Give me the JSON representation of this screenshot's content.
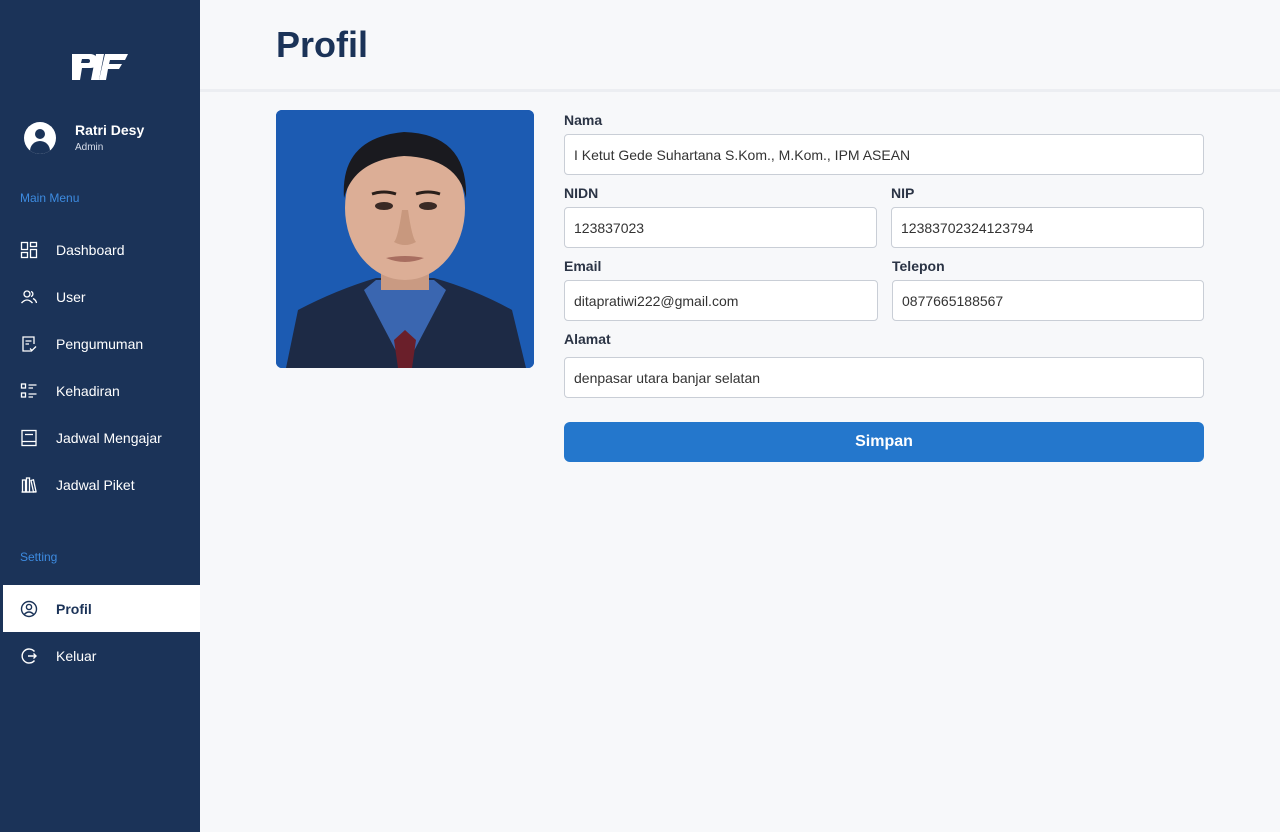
{
  "app": {
    "logo_text": "PIF"
  },
  "user": {
    "name": "Ratri Desy",
    "role": "Admin"
  },
  "sidebar": {
    "main_menu_label": "Main Menu",
    "main_items": [
      {
        "label": "Dashboard",
        "icon": "dashboard-icon"
      },
      {
        "label": "User",
        "icon": "users-icon"
      },
      {
        "label": "Pengumuman",
        "icon": "announcement-icon"
      },
      {
        "label": "Kehadiran",
        "icon": "attendance-list-icon"
      },
      {
        "label": "Jadwal Mengajar",
        "icon": "book-icon"
      },
      {
        "label": "Jadwal Piket",
        "icon": "library-icon"
      }
    ],
    "setting_label": "Setting",
    "setting_items": [
      {
        "label": "Profil",
        "icon": "user-circle-icon",
        "active": true
      },
      {
        "label": "Keluar",
        "icon": "logout-icon"
      }
    ]
  },
  "page": {
    "title": "Profil"
  },
  "form": {
    "nama": {
      "label": "Nama",
      "value": "I Ketut Gede Suhartana S.Kom., M.Kom., IPM ASEAN"
    },
    "nidn": {
      "label": "NIDN",
      "value": "123837023"
    },
    "nip": {
      "label": "NIP",
      "value": "12383702324123794"
    },
    "email": {
      "label": "Email",
      "value": "ditapratiwi222@gmail.com"
    },
    "telepon": {
      "label": "Telepon",
      "value": "0877665188567"
    },
    "alamat": {
      "label": "Alamat",
      "value": "denpasar utara banjar selatan"
    },
    "submit_label": "Simpan"
  },
  "colors": {
    "sidebar": "#1b3358",
    "accent": "#2477cc",
    "section_label": "#3d8be0",
    "photo_background": "#1f5fb8"
  }
}
